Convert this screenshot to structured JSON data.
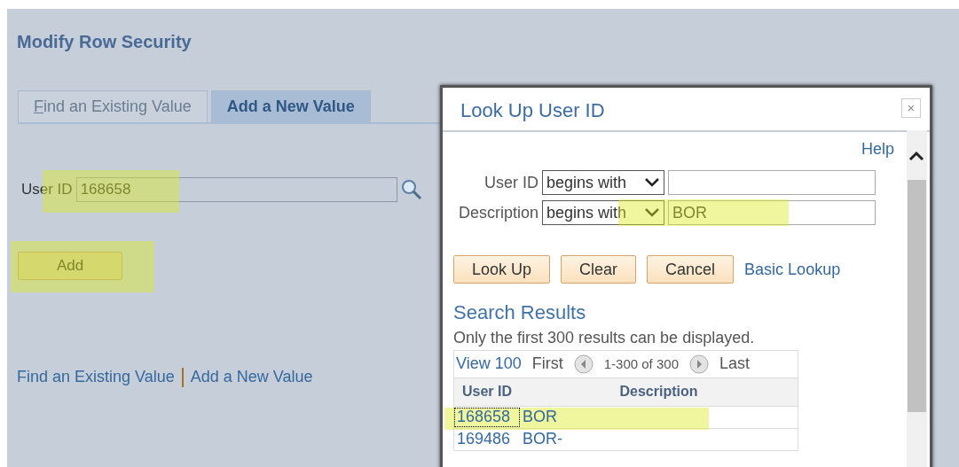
{
  "page": {
    "title": "Modify Row Security"
  },
  "tabs": [
    {
      "label": "Find an Existing Value",
      "selected": false
    },
    {
      "label": "Add a New Value",
      "selected": true
    }
  ],
  "user_id_field": {
    "label": "User ID",
    "value": "168658",
    "highlighted": true
  },
  "add_button": {
    "label": "Add",
    "highlighted": true
  },
  "footer_links": [
    "Find an Existing Value",
    "Add a New Value"
  ],
  "lookup_dialog": {
    "title": "Look Up User ID",
    "close": "×",
    "help": "Help",
    "criteria": [
      {
        "label": "User ID",
        "operator": "begins with",
        "highlighted": false
      },
      {
        "label": "Description",
        "operator": "begins with",
        "value": "BOR",
        "highlighted": true
      }
    ],
    "buttons": [
      "Look Up",
      "Clear",
      "Cancel"
    ],
    "basic_lookup": "Basic Lookup",
    "results_heading": "Search Results",
    "note": "Only the first 300 results can be displayed.",
    "grid": {
      "view": "View 100",
      "first": "First",
      "range": "1-300 of 300",
      "last": "Last",
      "columns": [
        "User ID",
        "Description"
      ],
      "rows": [
        {
          "user_id": "168658",
          "description": "BOR",
          "selected": true,
          "highlighted": true
        },
        {
          "user_id": "169486",
          "description": "BOR-",
          "selected": false,
          "highlighted": false
        }
      ]
    }
  }
}
